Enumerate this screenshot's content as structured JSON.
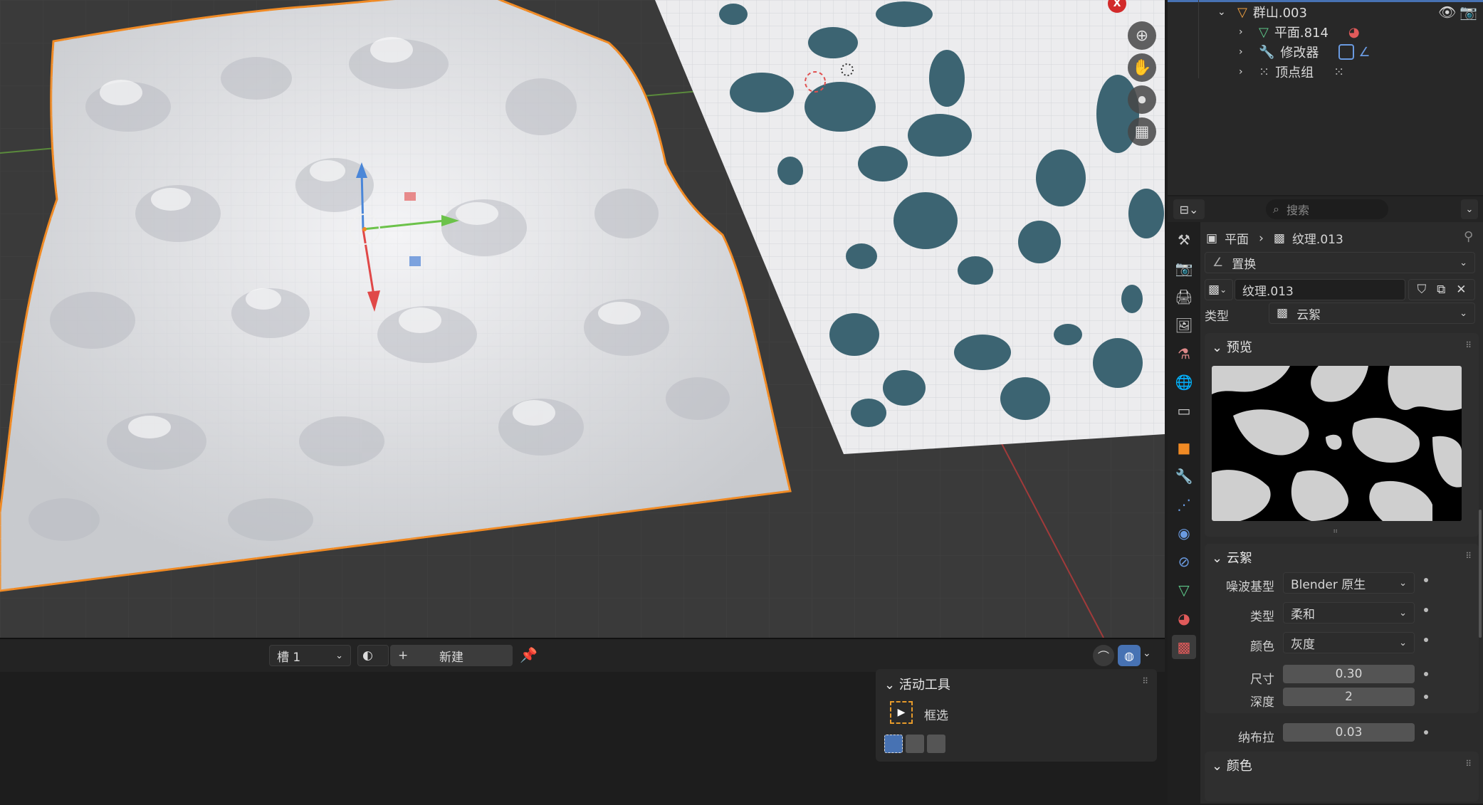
{
  "outliner": {
    "rows": [
      {
        "label": "群山.003",
        "icon": "mesh-data-icon"
      },
      {
        "label": "平面.814",
        "icon": "mesh-icon"
      },
      {
        "label": "修改器",
        "icon": "wrench-icon"
      },
      {
        "label": "顶点组",
        "icon": "vertex-group-icon"
      }
    ]
  },
  "properties": {
    "search_placeholder": "搜索",
    "breadcrumb": {
      "object": "平面",
      "texture": "纹理.013"
    },
    "modifier_name": "置换",
    "texture_name": "纹理.013",
    "type_label": "类型",
    "type_value": "云絮",
    "preview_section": "预览",
    "clouds_section": "云絮",
    "noise_basis_label": "噪波基型",
    "noise_basis_value": "Blender 原生",
    "noise_type_label": "类型",
    "noise_type_value": "柔和",
    "color_label": "颜色",
    "color_value": "灰度",
    "size_label": "尺寸",
    "size_value": "0.30",
    "depth_label": "深度",
    "depth_value": "2",
    "nabla_label": "纳布拉",
    "nabla_value": "0.03",
    "colors_section": "颜色"
  },
  "bottom": {
    "slot_value": "槽 1",
    "new_label": "新建",
    "active_tool_title": "活动工具",
    "tool_name": "框选"
  },
  "viewport": {
    "nav_x_label": "X"
  },
  "colors": {
    "accent": "#4772b3",
    "selection_outline": "#f08a24",
    "rock": "#3c6472"
  }
}
